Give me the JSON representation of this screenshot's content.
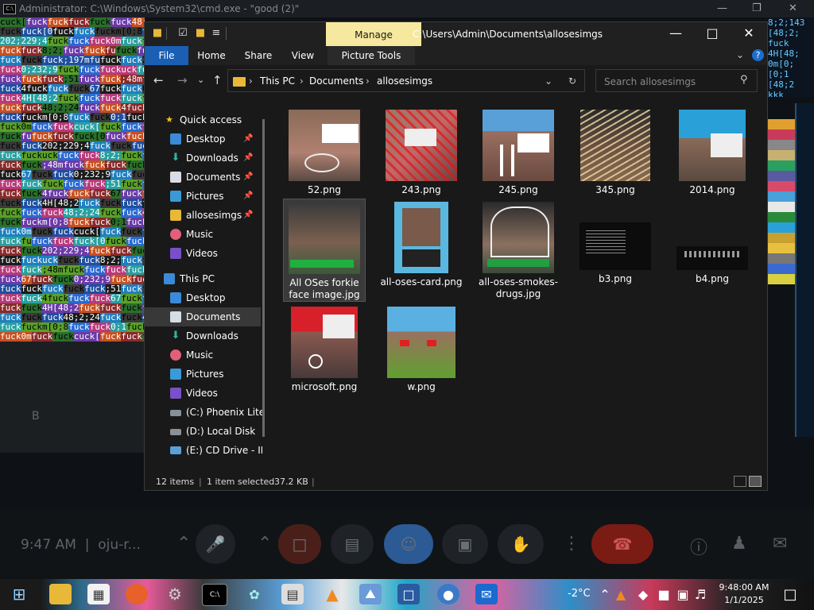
{
  "background": {
    "cmd_title": "Administrator: C:\\Windows\\System32\\cmd.exe - \"good (2)\"",
    "glitch_word": "fuck",
    "glitch_fragments": [
      "cuck[",
      "fuck",
      "8;2;",
      "fuck",
      ";51",
      "fu",
      "48;2;24",
      ";48mfuck",
      "fuck[0",
      "4fuck",
      "fuck;197mfu",
      "fuckm[0;8",
      "67",
      "202;229;4",
      "0;1",
      "0;232;9",
      "fuck0m",
      "4H[48;2",
      "fuckuck"
    ],
    "right_fragments": [
      "8;2;143",
      "[48;2;",
      "fuck",
      "4H[48;",
      "0m[0;",
      "[0;1",
      "[48;2",
      "kkk"
    ],
    "panel_letter": "B"
  },
  "window": {
    "manage_label": "Manage",
    "title": "C:\\Users\\Admin\\Documents\\allosesimgs",
    "tabs": [
      "File",
      "Home",
      "Share",
      "View",
      "Picture Tools"
    ],
    "help": "?",
    "breadcrumb": [
      "This PC",
      "Documents",
      "allosesimgs"
    ],
    "search_placeholder": "Search allosesimgs"
  },
  "nav": {
    "quick_access": "Quick access",
    "quick_items": [
      "Desktop",
      "Downloads",
      "Documents",
      "Pictures",
      "allosesimgs",
      "Music",
      "Videos"
    ],
    "this_pc": "This PC",
    "pc_items": [
      "Desktop",
      "Documents",
      "Downloads",
      "Music",
      "Pictures",
      "Videos",
      "(C:) Phoenix Lite",
      "(D:) Local Disk",
      "(E:) CD Drive - IR"
    ]
  },
  "files": [
    {
      "name": "52.png"
    },
    {
      "name": "243.png"
    },
    {
      "name": "245.png"
    },
    {
      "name": "345.png"
    },
    {
      "name": "2014.png"
    },
    {
      "name": "All OSes forkie face image.jpg",
      "selected": true
    },
    {
      "name": "all-oses-card.png"
    },
    {
      "name": "all-oses-smokes-drugs.jpg"
    },
    {
      "name": "b3.png"
    },
    {
      "name": "b4.png"
    },
    {
      "name": "microsoft.png"
    },
    {
      "name": "w.png"
    }
  ],
  "status": {
    "count": "12 items",
    "selected": "1 item selected",
    "size": "37.2 KB"
  },
  "meet": {
    "time": "9:47 AM",
    "code": "oju-r..."
  },
  "taskbar": {
    "temp": "-2°C",
    "time": "9:48:00 AM",
    "date": "1/1/2025"
  },
  "colors": {
    "file_tab": "#1a5fb4",
    "manage_tab": "#f6e89e",
    "selection": "#383838",
    "folder": "#e8b838"
  }
}
